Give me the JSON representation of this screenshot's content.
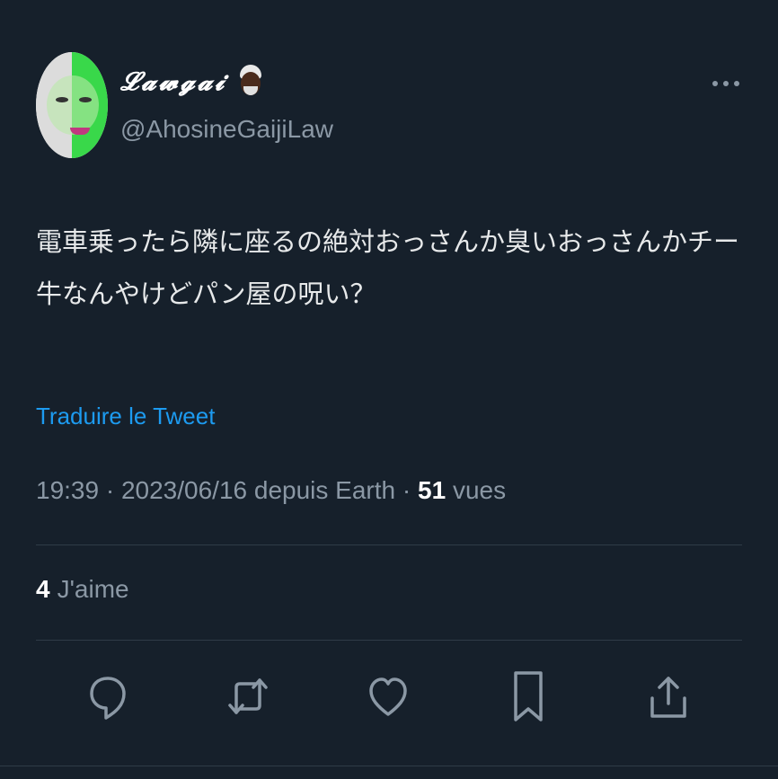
{
  "author": {
    "display_name": "𝓛𝓪𝔀𝓰𝓪𝓲",
    "handle": "@AhosineGaijiLaw"
  },
  "tweet": {
    "text": "電車乗ったら隣に座るの絶対おっさんか臭いおっさんかチー牛なんやけどパン屋の呪い？",
    "translate_label": "Traduire le Tweet",
    "time": "19:39",
    "date": "2023/06/16",
    "source": "depuis Earth",
    "views_count": "51",
    "views_label": "vues",
    "likes_count": "4",
    "likes_label": "J'aime"
  },
  "icons": {
    "reply": "reply-icon",
    "retweet": "retweet-icon",
    "like": "heart-icon",
    "bookmark": "bookmark-icon",
    "share": "share-icon",
    "more": "more-icon"
  },
  "colors": {
    "background": "#16202b",
    "link": "#1d9bf0",
    "secondary_text": "#8b98a5",
    "primary_text": "#e7e9ea"
  }
}
